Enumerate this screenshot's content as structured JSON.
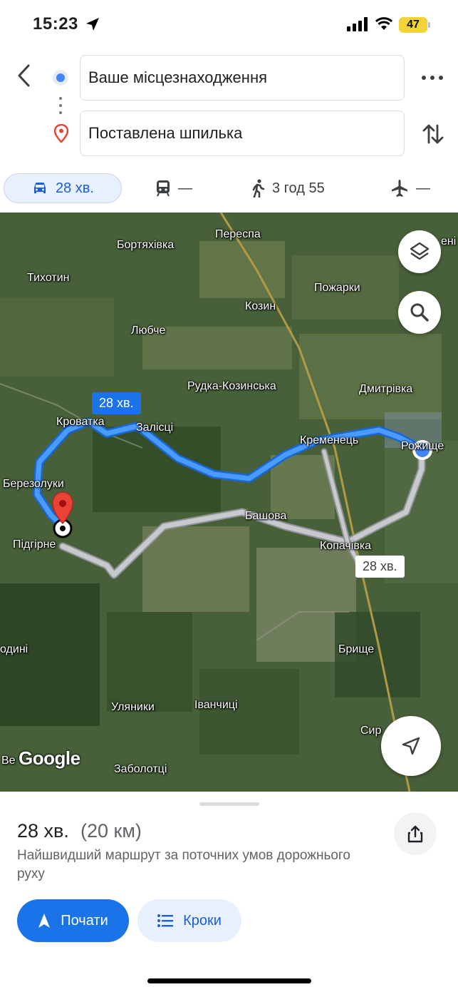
{
  "status_bar": {
    "time": "15:23",
    "battery": "47"
  },
  "header": {
    "origin": "Ваше місцезнаходження",
    "destination": "Поставлена шпилька"
  },
  "modes": {
    "drive": "28 хв.",
    "transit": "—",
    "walk": "3 год 55",
    "flight": "—"
  },
  "map": {
    "places": {
      "perespa": "Переспа",
      "bortiakhivka": "Бортяхівка",
      "tykhotyn": "Тихотин",
      "pozharky": "Пожарки",
      "kozyn": "Козин",
      "liubche": "Любче",
      "rudka": "Рудка-Козинська",
      "dmytrivka": "Дмитрівка",
      "krovatka": "Кроватка",
      "zalisci": "Залісці",
      "kremenets": "Кременець",
      "roshche": "Рожище",
      "berezoluky": "Березолуки",
      "bashova": "Башова",
      "pidgirne": "Підгірне",
      "kopachivka": "Копачівка",
      "rodyni": "одині",
      "brysche": "Брище",
      "ulianyky": "Уляники",
      "ivanchytsi": "Іванчиці",
      "syr": "Сир",
      "ves": "Ве",
      "zabolottsi": "Заболотці",
      "neighbor_right": "ені"
    },
    "route_primary_time": "28 хв.",
    "route_alt_time": "28 хв.",
    "logo": "Google"
  },
  "sheet": {
    "duration": "28 хв.",
    "distance": "(20 км)",
    "description": "Найшвидший маршрут за поточних умов дорожнього руху",
    "start_label": "Почати",
    "steps_label": "Кроки"
  },
  "colors": {
    "accent": "#1a73e8",
    "route": "#3b8cff",
    "alt_route": "#c7c9cc",
    "pin": "#ea4335"
  }
}
